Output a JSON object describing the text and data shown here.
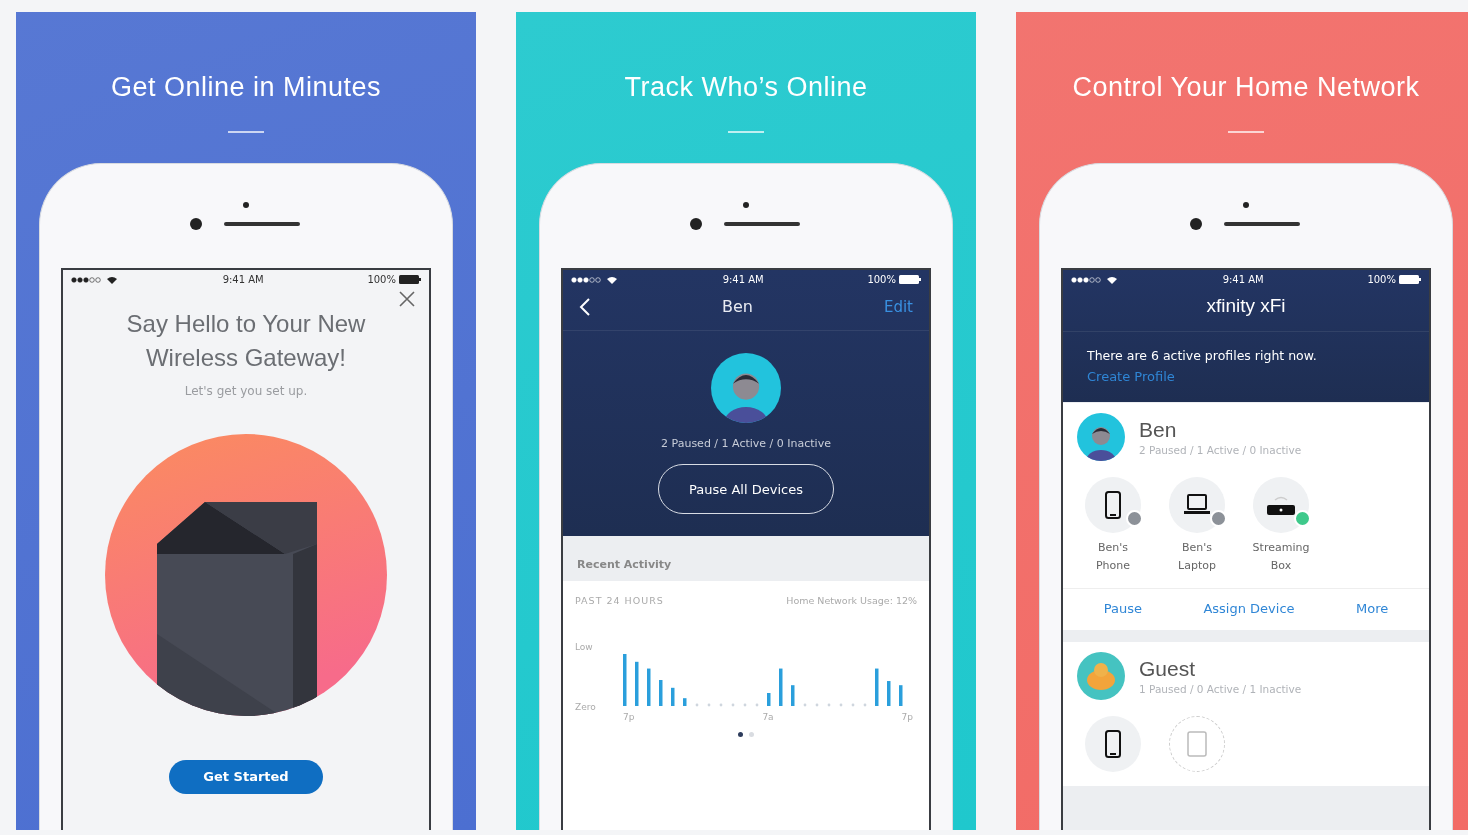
{
  "panels": [
    {
      "kind": "welcome",
      "color": "#4c6fd1",
      "title": "Get Online in Minutes",
      "status": {
        "time": "9:41 AM",
        "battery": "100%"
      },
      "screen": {
        "heading": "Say Hello to Your New Wireless Gateway!",
        "subheading": "Let's get you set up.",
        "button": "Get Started"
      }
    },
    {
      "kind": "profile",
      "color": "#1fc8cd",
      "title": "Track Who’s Online",
      "status": {
        "time": "9:41 AM",
        "battery": "100%"
      },
      "screen": {
        "name": "Ben",
        "edit": "Edit",
        "summary": "2 Paused / 1 Active / 0 Inactive",
        "button": "Pause All Devices",
        "section": "Recent Activity",
        "period": "PAST 24 HOURS",
        "usage": "Home Network Usage: 12%",
        "y_labels": [
          "Low",
          "Zero"
        ],
        "x_labels": [
          "7p",
          "7a",
          "7p"
        ],
        "page_dots": [
          {
            "selected": true
          },
          {
            "selected": false
          }
        ]
      }
    },
    {
      "kind": "home",
      "color": "#f26b66",
      "title": "Control Your Home Network",
      "status": {
        "time": "9:41 AM",
        "battery": "100%"
      },
      "screen": {
        "logo": "xfinity xFi",
        "message": "There are 6 active profiles right now.",
        "link": "Create Profile",
        "profiles": [
          {
            "kind": "person",
            "name": "Ben",
            "summary": "2 Paused / 1 Active / 0 Inactive",
            "devices": [
              {
                "kind": "phone",
                "label": "Ben's Phone",
                "color": "#8c9198",
                "dashed": false
              },
              {
                "kind": "laptop",
                "label": "Ben's Laptop",
                "color": "#8c9198",
                "dashed": false
              },
              {
                "kind": "streaming",
                "label": "Streaming Box",
                "color": "#3ec98b",
                "dashed": false
              }
            ],
            "actions": [
              "Pause",
              "Assign Device",
              "More"
            ]
          },
          {
            "kind": "guest",
            "name": "Guest",
            "summary": "1 Paused / 0 Active / 1 Inactive",
            "devices": [
              {
                "kind": "phone",
                "dashed": false
              },
              {
                "kind": "tablet",
                "dashed": true
              }
            ]
          }
        ]
      }
    }
  ]
}
